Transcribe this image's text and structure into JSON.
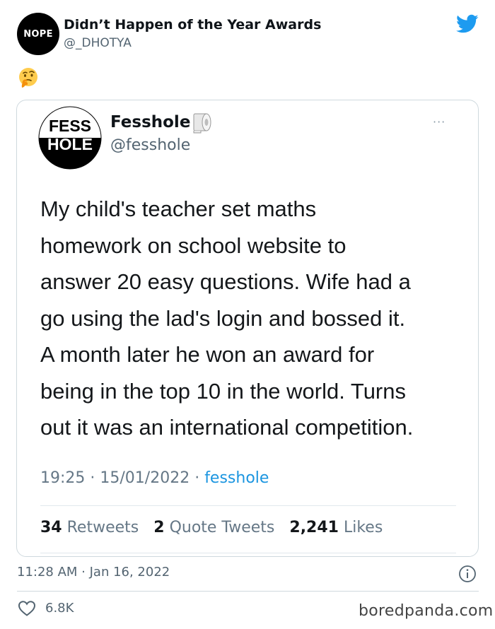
{
  "tweet": {
    "avatar_text": "NOPE",
    "author_name": "Didn’t Happen of the Year Awards",
    "author_handle": "@_DHOTYA",
    "emoji": "thinking-face",
    "timestamp": "11:28 AM · Jan 16, 2022",
    "likes": "6.8K"
  },
  "quoted": {
    "avatar_line1": "FESS",
    "avatar_line2": "HOLE",
    "name": "Fesshole",
    "handle": "@fesshole",
    "more": "···",
    "body_lines": [
      "My child's teacher set maths",
      "homework on school website to",
      "answer 20 easy questions. Wife had a",
      "go using the lad's login and bossed it.",
      "A month later he won an award for",
      "being in the top 10 in the world. Turns",
      "out it was an international competition."
    ],
    "time": "19:25",
    "date": "15/01/2022",
    "source": "fesshole",
    "retweets_count": "34",
    "retweets_label": "Retweets",
    "quote_count": "2",
    "quote_label": "Quote Tweets",
    "likes_count": "2,241",
    "likes_label": "Likes"
  },
  "watermark": "boredpanda.com",
  "colors": {
    "twitter_blue": "#1d9bf0",
    "link_blue": "#1b95e0",
    "text": "#0f1419",
    "muted": "#536471",
    "border": "#cfd9de"
  }
}
